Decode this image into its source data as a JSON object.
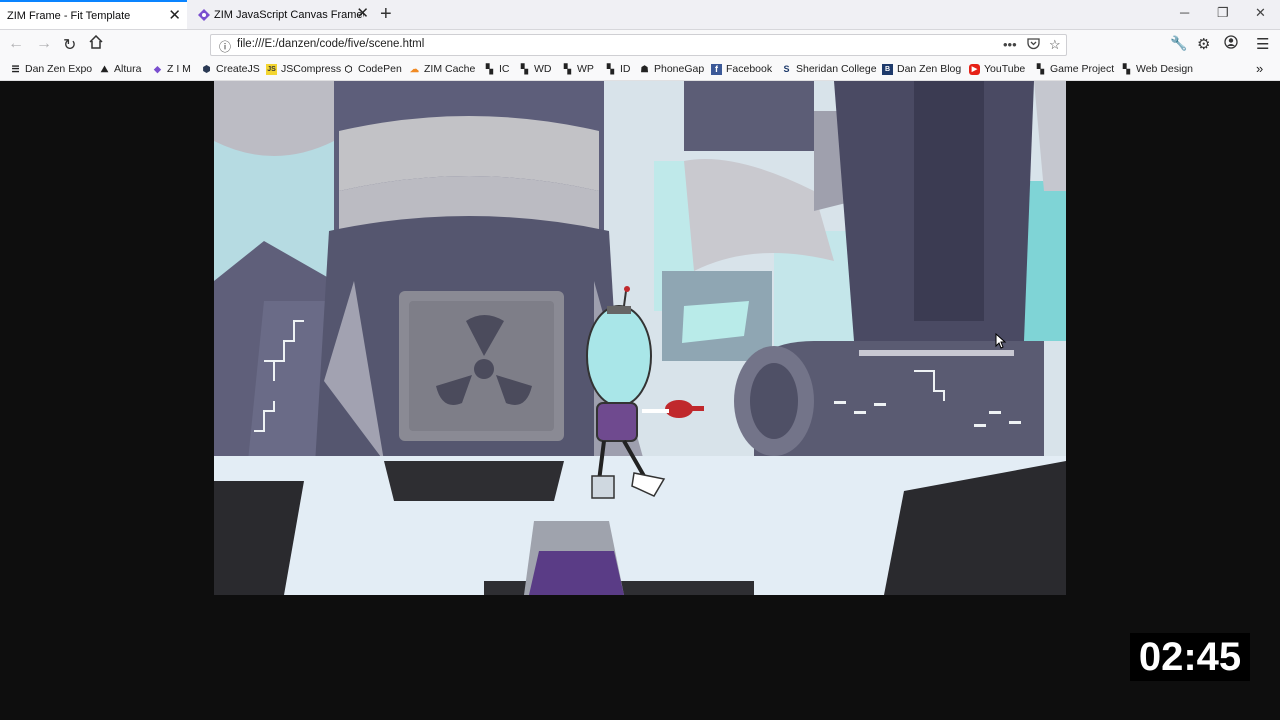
{
  "tabs": [
    {
      "title": "ZIM Frame - Fit Template",
      "active": true
    },
    {
      "title": "ZIM JavaScript Canvas Framew",
      "active": false
    }
  ],
  "window_controls": {
    "minimize": "─",
    "restore": "❐",
    "close": "✕"
  },
  "address_bar": {
    "url": "file:///E:/danzen/code/five/scene.html"
  },
  "bookmarks": [
    {
      "label": "Dan Zen Expo",
      "icon": "list-icon"
    },
    {
      "label": "Altura",
      "icon": "mountain-icon"
    },
    {
      "label": "Z I M",
      "icon": "zim-icon"
    },
    {
      "label": "CreateJS",
      "icon": "cube-icon"
    },
    {
      "label": "JSCompress",
      "icon": "js-icon"
    },
    {
      "label": "CodePen",
      "icon": "codepen-icon"
    },
    {
      "label": "ZIM Cache",
      "icon": "cloud-icon"
    },
    {
      "label": "IC",
      "icon": "grid-icon"
    },
    {
      "label": "WD",
      "icon": "grid-icon"
    },
    {
      "label": "WP",
      "icon": "grid-icon"
    },
    {
      "label": "ID",
      "icon": "grid-icon"
    },
    {
      "label": "PhoneGap",
      "icon": "phonegap-icon"
    },
    {
      "label": "Facebook",
      "icon": "facebook-icon"
    },
    {
      "label": "Sheridan College",
      "icon": "sheridan-icon"
    },
    {
      "label": "Dan Zen Blog",
      "icon": "blog-icon"
    },
    {
      "label": "YouTube",
      "icon": "youtube-icon"
    },
    {
      "label": "Game Project",
      "icon": "grid-icon"
    },
    {
      "label": "Web Design",
      "icon": "grid-icon"
    }
  ],
  "timer": {
    "value": "02:45"
  },
  "colors": {
    "accent": "#0a84ff",
    "page_bg": "#0e0e0e"
  }
}
